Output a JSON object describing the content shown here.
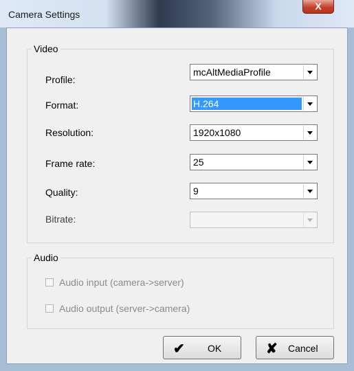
{
  "window": {
    "title": "Camera Settings",
    "close_glyph": "X"
  },
  "video": {
    "legend": "Video",
    "rows": [
      {
        "label": "Profile:",
        "value": "mcAltMediaProfile"
      },
      {
        "label": "Format:",
        "value": "H.264"
      },
      {
        "label": "Resolution:",
        "value": "1920x1080"
      },
      {
        "label": "Frame rate:",
        "value": "25"
      },
      {
        "label": "Quality:",
        "value": "9"
      },
      {
        "label": "Bitrate:",
        "value": ""
      }
    ]
  },
  "audio": {
    "legend": "Audio",
    "input_label": "Audio input (camera->server)",
    "output_label": "Audio output (server->camera)"
  },
  "buttons": {
    "ok_label": "OK",
    "cancel_label": "Cancel",
    "ok_icon": "checkmark-icon",
    "cancel_icon": "x-icon"
  }
}
